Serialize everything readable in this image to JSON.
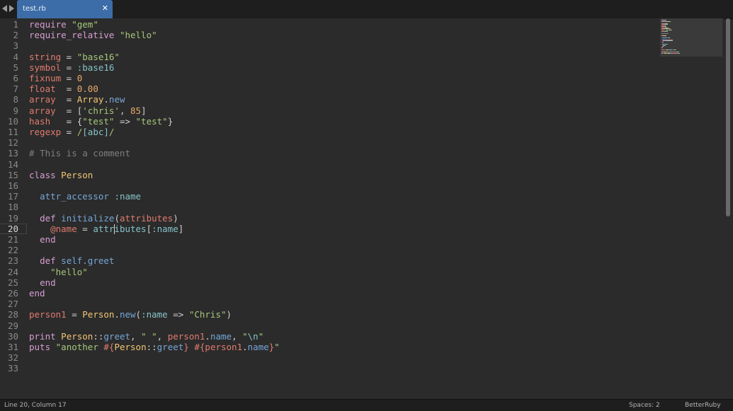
{
  "tabs": [
    {
      "label": "test.rb",
      "active": true,
      "close_icon": "close-icon"
    }
  ],
  "nav": {
    "back_icon": "arrow-left-icon",
    "forward_icon": "arrow-right-icon"
  },
  "status": {
    "position": "Line 20, Column 17",
    "indentation": "Spaces: 2",
    "syntax": "BetterRuby"
  },
  "editor": {
    "current_line": 20,
    "current_column": 17,
    "colors": {
      "background": "#2b2b2b",
      "keyword": "#d79ed3",
      "string": "#a6c77a",
      "variable": "#e07b6f",
      "number": "#e8a86a",
      "constant": "#f2c674",
      "function": "#76a6d6",
      "symbol": "#86c3c9",
      "comment": "#7f7f7f",
      "tab_active": "#3d6da8"
    },
    "lines": [
      {
        "n": "1",
        "t": [
          [
            "k",
            "require"
          ],
          [
            "p",
            " "
          ],
          [
            "s",
            "\"gem\""
          ]
        ]
      },
      {
        "n": "2",
        "t": [
          [
            "k",
            "require_relative"
          ],
          [
            "p",
            " "
          ],
          [
            "s",
            "\"hello\""
          ]
        ]
      },
      {
        "n": "3",
        "t": []
      },
      {
        "n": "4",
        "t": [
          [
            "v",
            "string"
          ],
          [
            "p",
            " = "
          ],
          [
            "s",
            "\"base16\""
          ]
        ]
      },
      {
        "n": "5",
        "t": [
          [
            "v",
            "symbol"
          ],
          [
            "p",
            " = "
          ],
          [
            "sy",
            ":base16"
          ]
        ]
      },
      {
        "n": "6",
        "t": [
          [
            "v",
            "fixnum"
          ],
          [
            "p",
            " = "
          ],
          [
            "n",
            "0"
          ]
        ]
      },
      {
        "n": "7",
        "t": [
          [
            "v",
            "float"
          ],
          [
            "p",
            "  = "
          ],
          [
            "n",
            "0.00"
          ]
        ]
      },
      {
        "n": "8",
        "t": [
          [
            "v",
            "array"
          ],
          [
            "p",
            "  = "
          ],
          [
            "c",
            "Array"
          ],
          [
            "p",
            "."
          ],
          [
            "f",
            "new"
          ]
        ]
      },
      {
        "n": "9",
        "t": [
          [
            "v",
            "array"
          ],
          [
            "p",
            "  = ["
          ],
          [
            "s",
            "'chris'"
          ],
          [
            "p",
            ", "
          ],
          [
            "n",
            "85"
          ],
          [
            "p",
            "]"
          ]
        ]
      },
      {
        "n": "10",
        "t": [
          [
            "v",
            "hash"
          ],
          [
            "p",
            "   = {"
          ],
          [
            "s",
            "\"test\""
          ],
          [
            "p",
            " => "
          ],
          [
            "s",
            "\"test\""
          ],
          [
            "p",
            "}"
          ]
        ]
      },
      {
        "n": "11",
        "t": [
          [
            "v",
            "regexp"
          ],
          [
            "p",
            " = "
          ],
          [
            "s",
            "/"
          ],
          [
            "sy",
            "[abc]"
          ],
          [
            "s",
            "/"
          ]
        ]
      },
      {
        "n": "12",
        "t": []
      },
      {
        "n": "13",
        "t": [
          [
            "cm",
            "# This is a comment"
          ]
        ]
      },
      {
        "n": "14",
        "t": []
      },
      {
        "n": "15",
        "t": [
          [
            "k",
            "class"
          ],
          [
            "p",
            " "
          ],
          [
            "c",
            "Person"
          ]
        ]
      },
      {
        "n": "16",
        "t": []
      },
      {
        "n": "17",
        "t": [
          [
            "p",
            "  "
          ],
          [
            "f",
            "attr_accessor"
          ],
          [
            "p",
            " "
          ],
          [
            "sy",
            ":name"
          ]
        ]
      },
      {
        "n": "18",
        "t": []
      },
      {
        "n": "19",
        "t": [
          [
            "p",
            "  "
          ],
          [
            "k",
            "def"
          ],
          [
            "p",
            " "
          ],
          [
            "f",
            "initialize"
          ],
          [
            "p",
            "("
          ],
          [
            "v",
            "attributes"
          ],
          [
            "p",
            ")"
          ]
        ]
      },
      {
        "n": "20",
        "t": [
          [
            "p",
            "    "
          ],
          [
            "v",
            "@name"
          ],
          [
            "p",
            " = "
          ],
          [
            "sy",
            "attributes"
          ],
          [
            "p",
            "["
          ],
          [
            "sy",
            ":name"
          ],
          [
            "p",
            "]"
          ]
        ]
      },
      {
        "n": "21",
        "t": [
          [
            "p",
            "  "
          ],
          [
            "k",
            "end"
          ]
        ]
      },
      {
        "n": "22",
        "t": []
      },
      {
        "n": "23",
        "t": [
          [
            "p",
            "  "
          ],
          [
            "k",
            "def"
          ],
          [
            "p",
            " "
          ],
          [
            "f",
            "self.greet"
          ]
        ]
      },
      {
        "n": "24",
        "t": [
          [
            "p",
            "    "
          ],
          [
            "s",
            "\"hello\""
          ]
        ]
      },
      {
        "n": "25",
        "t": [
          [
            "p",
            "  "
          ],
          [
            "k",
            "end"
          ]
        ]
      },
      {
        "n": "26",
        "t": [
          [
            "k",
            "end"
          ]
        ]
      },
      {
        "n": "27",
        "t": []
      },
      {
        "n": "28",
        "t": [
          [
            "v",
            "person1"
          ],
          [
            "p",
            " = "
          ],
          [
            "c",
            "Person"
          ],
          [
            "p",
            "."
          ],
          [
            "f",
            "new"
          ],
          [
            "p",
            "("
          ],
          [
            "sy",
            ":name"
          ],
          [
            "p",
            " => "
          ],
          [
            "s",
            "\"Chris\""
          ],
          [
            "p",
            ")"
          ]
        ]
      },
      {
        "n": "29",
        "t": []
      },
      {
        "n": "30",
        "t": [
          [
            "k",
            "print"
          ],
          [
            "p",
            " "
          ],
          [
            "c",
            "Person"
          ],
          [
            "p",
            "::"
          ],
          [
            "f",
            "greet"
          ],
          [
            "p",
            ", "
          ],
          [
            "s",
            "\" \""
          ],
          [
            "p",
            ", "
          ],
          [
            "v",
            "person1"
          ],
          [
            "p",
            "."
          ],
          [
            "f",
            "name"
          ],
          [
            "p",
            ", "
          ],
          [
            "s",
            "\""
          ],
          [
            "sy",
            "\\n"
          ],
          [
            "s",
            "\""
          ]
        ]
      },
      {
        "n": "31",
        "t": [
          [
            "k",
            "puts"
          ],
          [
            "p",
            " "
          ],
          [
            "s",
            "\"another "
          ],
          [
            "v",
            "#{"
          ],
          [
            "c",
            "Person"
          ],
          [
            "p",
            "::"
          ],
          [
            "f",
            "greet"
          ],
          [
            "v",
            "}"
          ],
          [
            "s",
            " "
          ],
          [
            "v",
            "#{"
          ],
          [
            "v",
            "person1"
          ],
          [
            "p",
            "."
          ],
          [
            "f",
            "name"
          ],
          [
            "v",
            "}"
          ],
          [
            "s",
            "\""
          ]
        ]
      },
      {
        "n": "32",
        "t": []
      },
      {
        "n": "33",
        "t": []
      }
    ]
  }
}
